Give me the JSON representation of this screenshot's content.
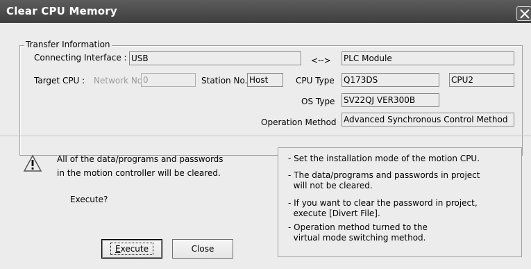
{
  "window": {
    "title": "Clear CPU Memory"
  },
  "transfer": {
    "legend": "Transfer Information",
    "connecting_interface_label": "Connecting Interface :",
    "connecting_interface_value": "USB",
    "arrow": "<-->",
    "plc_module": "PLC Module",
    "target_cpu_label": "Target CPU :",
    "network_no_label": "Network No.",
    "network_no_value": "0",
    "station_no_label": "Station No.",
    "station_no_value": "Host",
    "cpu_type_label": "CPU Type",
    "cpu_type_value": "Q173DS",
    "cpu_slot_value": "CPU2",
    "os_type_label": "OS Type",
    "os_type_value": "SV22QJ VER300B",
    "operation_method_label": "Operation Method",
    "operation_method_value": "Advanced Synchronous Control Method"
  },
  "message": {
    "line1": "All of the data/programs and passwords",
    "line2": "in the motion controller will be cleared.",
    "prompt": "Execute?"
  },
  "notes": {
    "n1": "- Set the installation mode of the motion CPU.",
    "n2a": "- The data/programs and passwords in project",
    "n2b": "  will not be cleared.",
    "n3a": "- If you want to clear the password in project,",
    "n3b": "  execute [Divert File].",
    "n4a": "- Operation method turned to the",
    "n4b": "  virtual mode switching method."
  },
  "buttons": {
    "execute_first": "E",
    "execute_rest": "xecute",
    "close": "Close"
  },
  "icons": {
    "warning": "warning-triangle-icon",
    "close": "close-x-icon"
  },
  "colors": {
    "titlebar": "#4a4a4a",
    "dialog_bg": "#ececec"
  }
}
